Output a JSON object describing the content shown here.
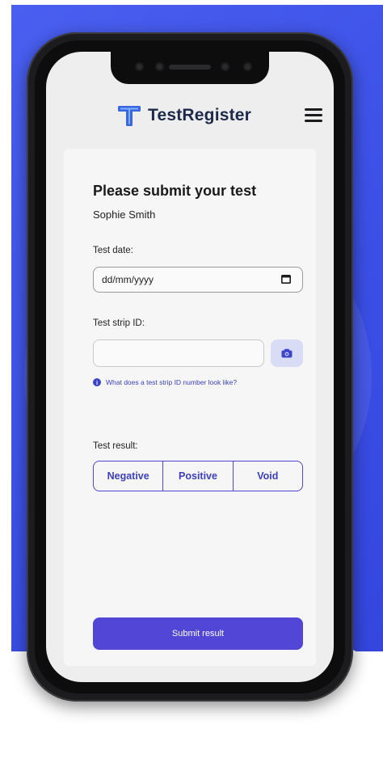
{
  "app": {
    "name": "TestRegister"
  },
  "form": {
    "title": "Please submit your test",
    "user_name": "Sophie Smith",
    "date_label": "Test date:",
    "date_placeholder": "dd/mm/yyyy",
    "strip_label": "Test strip ID:",
    "strip_value": "",
    "help_text": "What does a test strip ID number look like?",
    "result_label": "Test result:",
    "result_options": [
      "Negative",
      "Positive",
      "Void"
    ],
    "submit_label": "Submit result"
  },
  "colors": {
    "accent": "#5146d6",
    "background": "#3b4fe6"
  },
  "icons": {
    "logo": "t-logo-icon",
    "menu": "hamburger-menu-icon",
    "calendar": "calendar-icon",
    "camera": "camera-icon",
    "info": "info-icon"
  }
}
